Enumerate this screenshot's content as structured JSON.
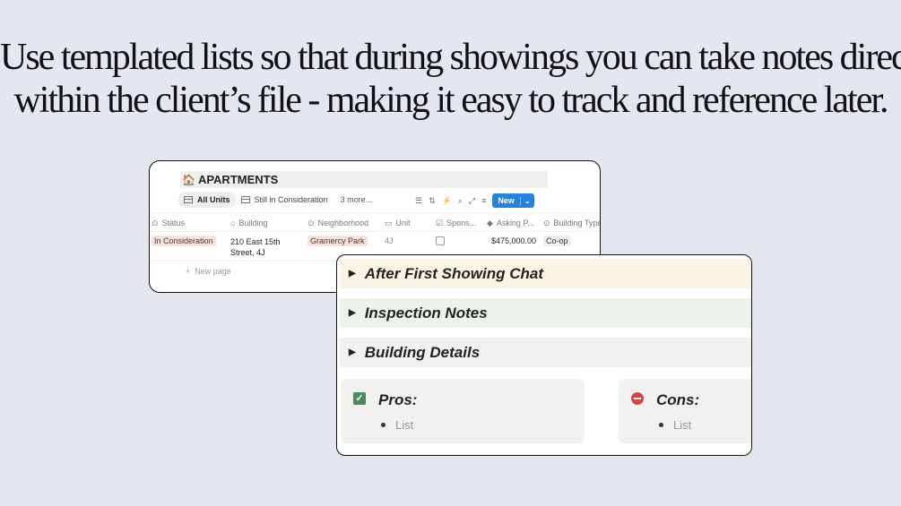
{
  "headline": {
    "line1": "Use templated lists so that during showings you can take notes directly",
    "line2": "within the client’s file - making it easy to track and reference later."
  },
  "database": {
    "icon": "house-emoji",
    "title": "APARTMENTS",
    "views": [
      "All Units",
      "Still in Consideration"
    ],
    "more_views": "3 more...",
    "new_button": "New",
    "columns": [
      "Status",
      "Building",
      "Neighborhood",
      "Unit",
      "Spons...",
      "Asking P...",
      "Building Type"
    ],
    "row": {
      "status": "In Consideration",
      "building": "210 East 15th Street, 4J",
      "neighborhood": "Gramercy Park",
      "unit": "4J",
      "sponsor": false,
      "asking_price": "$475,000.00",
      "building_type": "Co-op"
    },
    "new_page": "New page",
    "colors": {
      "accent": "#2383e2",
      "status_tag": "#f7e3dc"
    }
  },
  "notes": {
    "toggles": [
      {
        "label": "After First Showing Chat",
        "color": "#fbf3e4"
      },
      {
        "label": "Inspection Notes",
        "color": "#edf3ec"
      },
      {
        "label": "Building Details",
        "color": "#f1f1ef"
      }
    ],
    "pros": {
      "title": "Pros:",
      "item": "List",
      "icon": "checkbox-checked-icon"
    },
    "cons": {
      "title": "Cons:",
      "item": "List",
      "icon": "no-entry-icon"
    }
  }
}
